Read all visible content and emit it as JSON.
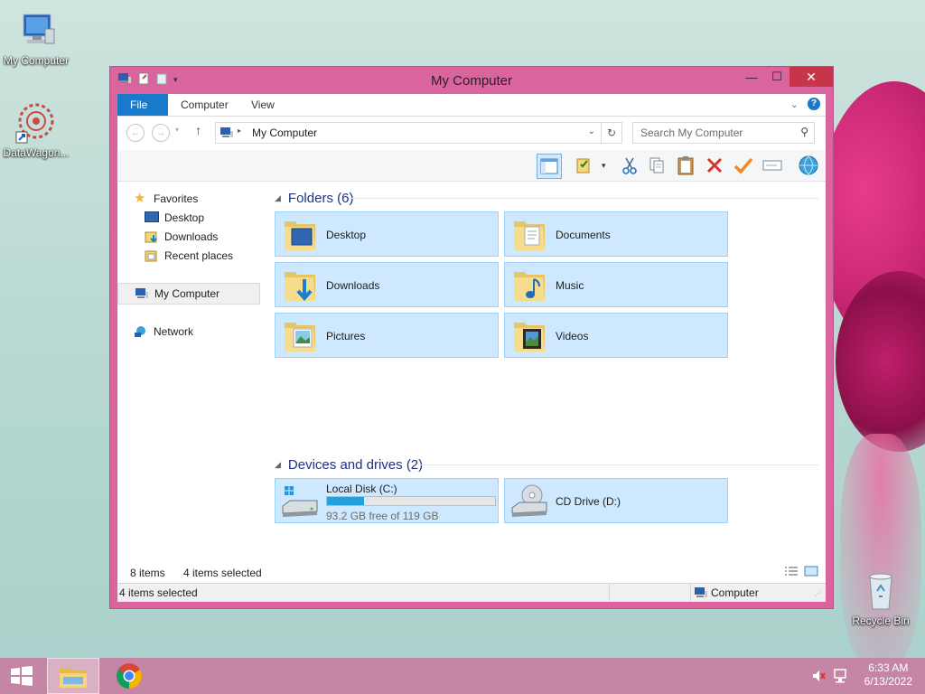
{
  "desktop": {
    "icons": [
      {
        "label": "My Computer"
      },
      {
        "label": "DataWagon..."
      },
      {
        "label": "Recycle Bin"
      }
    ]
  },
  "window": {
    "title": "My Computer",
    "ribbon_tabs": [
      "File",
      "Computer",
      "View"
    ],
    "address": "My Computer",
    "search_placeholder": "Search My Computer"
  },
  "nav": {
    "favorites": "Favorites",
    "desktop": "Desktop",
    "downloads": "Downloads",
    "recent": "Recent places",
    "computer": "My Computer",
    "network": "Network"
  },
  "content": {
    "folders_header": "Folders (6)",
    "folders": [
      "Desktop",
      "Documents",
      "Downloads",
      "Music",
      "Pictures",
      "Videos"
    ],
    "drives_header": "Devices and drives (2)",
    "drives": [
      {
        "name": "Local Disk (C:)",
        "free": "93.2 GB free of 119 GB",
        "used_fraction": 0.22
      },
      {
        "name": "CD Drive (D:)"
      }
    ]
  },
  "status": {
    "item_count": "8 items",
    "selected": "4 items selected",
    "bar_selected": "4 items selected",
    "zone": "Computer"
  },
  "taskbar": {
    "time": "6:33 AM",
    "date": "6/13/2022"
  },
  "colors": {
    "window_frame": "#d9649e",
    "accent": "#1979ca",
    "tile_bg": "#cde8ff",
    "tile_border": "#99d1ff",
    "progress": "#26a0da",
    "taskbar": "#c586a5"
  }
}
